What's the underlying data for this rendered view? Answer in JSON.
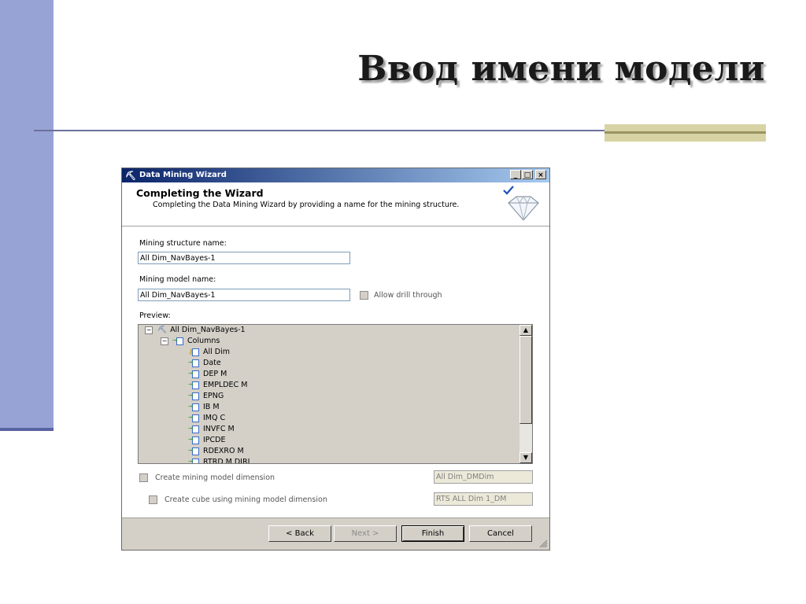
{
  "slide": {
    "title": "Ввод имени модели"
  },
  "dialog": {
    "window_title": "Data Mining Wizard",
    "header_title": "Completing the Wizard",
    "header_subtitle": "Completing the Data Mining Wizard by providing a name for the mining structure.",
    "structure_label": "Mining structure name:",
    "structure_value": "All Dim_NavBayes-1",
    "model_label": "Mining model name:",
    "model_value": "All Dim_NavBayes-1",
    "drill_label": "Allow drill through",
    "preview_label": "Preview:",
    "tree": {
      "root": "All Dim_NavBayes-1",
      "group": "Columns",
      "key_column": "All Dim",
      "columns": [
        "Date",
        "DEP M",
        "EMPLDEC M",
        "EPNG",
        "IB M",
        "IMQ C",
        "INVFC M",
        "IPCDE",
        "RDEXRO M",
        "RTRD M DIRI"
      ]
    },
    "create_dimension_label": "Create mining model dimension",
    "dimension_value": "All Dim_DMDim",
    "create_cube_label": "Create cube using mining model dimension",
    "cube_value": "RTS ALL Dim 1_DM",
    "buttons": {
      "back": "< Back",
      "next": "Next >",
      "finish": "Finish",
      "cancel": "Cancel"
    },
    "titlebar_buttons": {
      "minimize": "_",
      "maximize": "□",
      "close": "×"
    }
  },
  "colors": {
    "side_bar": "#97a3d5",
    "accent_block": "#d7d3a4",
    "titlebar_start": "#0a246a"
  }
}
